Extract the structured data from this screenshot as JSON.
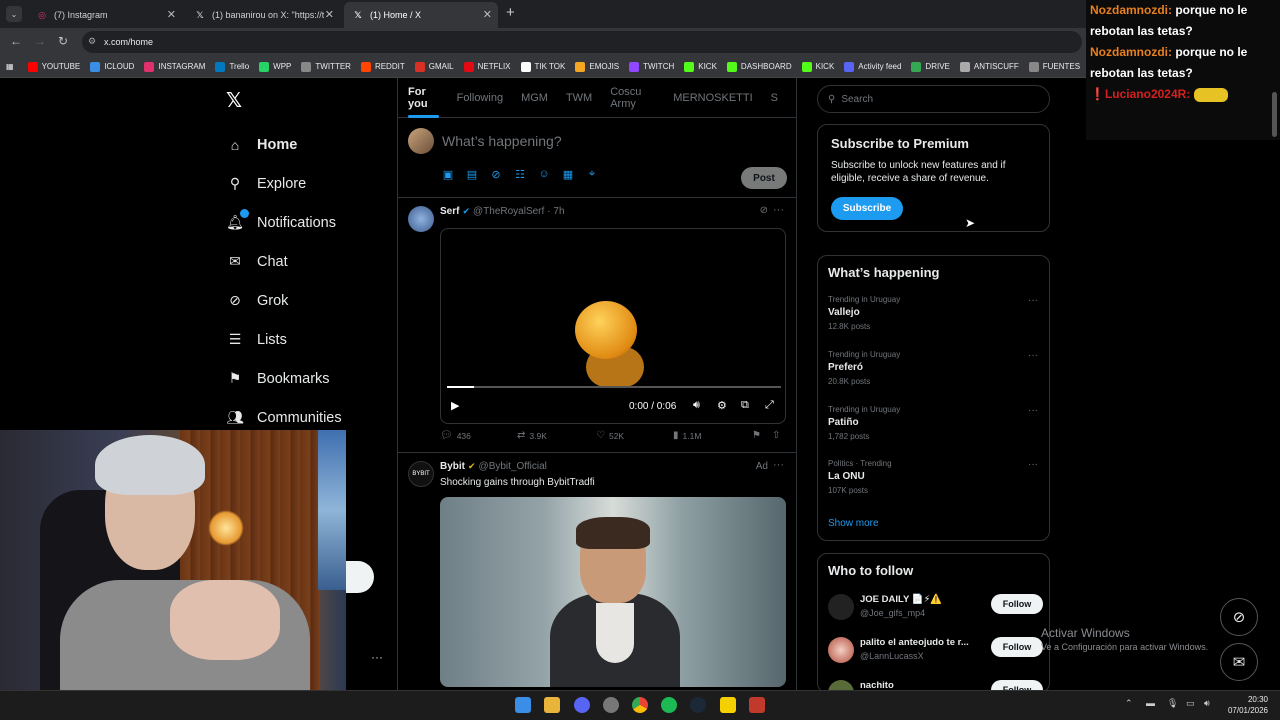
{
  "browser": {
    "tabs": [
      {
        "label": "(7) Instagram",
        "icon": "instagram-icon"
      },
      {
        "label": "(1) bananirou on X: \"https://t.co",
        "icon": "x-icon"
      },
      {
        "label": "(1) Home / X",
        "icon": "x-icon"
      }
    ],
    "url": "x.com/home",
    "bookmarks": [
      "YOUTUBE",
      "ICLOUD",
      "INSTAGRAM",
      "Trello",
      "WPP",
      "TWITTER",
      "REDDIT",
      "GMAIL",
      "NETFLIX",
      "TIK TOK",
      "EMOJIS",
      "TWITCH",
      "KICK",
      "DASHBOARD",
      "KICK",
      "Activity feed",
      "DRIVE",
      "ANTISCUFF",
      "FUENTES"
    ]
  },
  "sidebar": {
    "items": [
      {
        "label": "Home",
        "icon": "home-icon"
      },
      {
        "label": "Explore",
        "icon": "search-icon"
      },
      {
        "label": "Notifications",
        "icon": "bell-icon"
      },
      {
        "label": "Chat",
        "icon": "envelope-icon"
      },
      {
        "label": "Grok",
        "icon": "grok-icon"
      },
      {
        "label": "Lists",
        "icon": "list-icon"
      },
      {
        "label": "Bookmarks",
        "icon": "bookmark-icon"
      },
      {
        "label": "Communities",
        "icon": "people-icon"
      }
    ]
  },
  "feed": {
    "tabs": [
      "For you",
      "Following",
      "MGM",
      "TWM",
      "Coscu Army",
      "MERNOSKETTI",
      "S"
    ],
    "composer_placeholder": "What’s happening?",
    "post_label": "Post",
    "tweets": [
      {
        "name": "Serf",
        "handle": "@TheRoyalSerf",
        "time": "· 7h",
        "video_time": "0:00 / 0:06",
        "video_progress": 0.08,
        "replies": "436",
        "reposts": "3.9K",
        "likes": "52K",
        "views": "1.1M"
      },
      {
        "name": "Bybit",
        "handle": "@Bybit_Official",
        "ad_label": "Ad",
        "text": "Shocking gains through BybitTradfi"
      }
    ]
  },
  "right": {
    "search_placeholder": "Search",
    "premium": {
      "title": "Subscribe to Premium",
      "text": "Subscribe to unlock new features and if eligible, receive a share of revenue.",
      "button": "Subscribe"
    },
    "happening": {
      "title": "What’s happening",
      "trends": [
        {
          "context": "Trending in Uruguay",
          "name": "Vallejo",
          "posts": "12.8K posts"
        },
        {
          "context": "Trending in Uruguay",
          "name": "Preferó",
          "posts": "20.8K posts"
        },
        {
          "context": "Trending in Uruguay",
          "name": "Patiño",
          "posts": "1,782 posts"
        },
        {
          "context": "Politics · Trending",
          "name": "La ONU",
          "posts": "107K posts"
        }
      ],
      "show_more": "Show more"
    },
    "who_to_follow": {
      "title": "Who to follow",
      "follow_label": "Follow",
      "users": [
        {
          "name": "JOE DAILY 📄⚡⚠️",
          "handle": "@Joe_gifs_mp4"
        },
        {
          "name": "palito el anteojudo te r...",
          "handle": "@LannLucassX"
        },
        {
          "name": "nachito",
          "handle": ""
        }
      ]
    }
  },
  "chat": {
    "lines": [
      {
        "user": "Nozdamnozdi:",
        "msg": "porque no le"
      },
      {
        "user": "",
        "msg": "rebotan las tetas?"
      },
      {
        "user": "Nozdamnozdi:",
        "msg": "porque no le"
      },
      {
        "user": "",
        "msg": "rebotan las tetas?"
      },
      {
        "user": "Luciano2024R:",
        "msg": ""
      }
    ]
  },
  "windows": {
    "activate_title": "Activar Windows",
    "activate_sub": "Ve a Configuración para activar Windows.",
    "time": "20:30",
    "date": "07/01/2026"
  }
}
